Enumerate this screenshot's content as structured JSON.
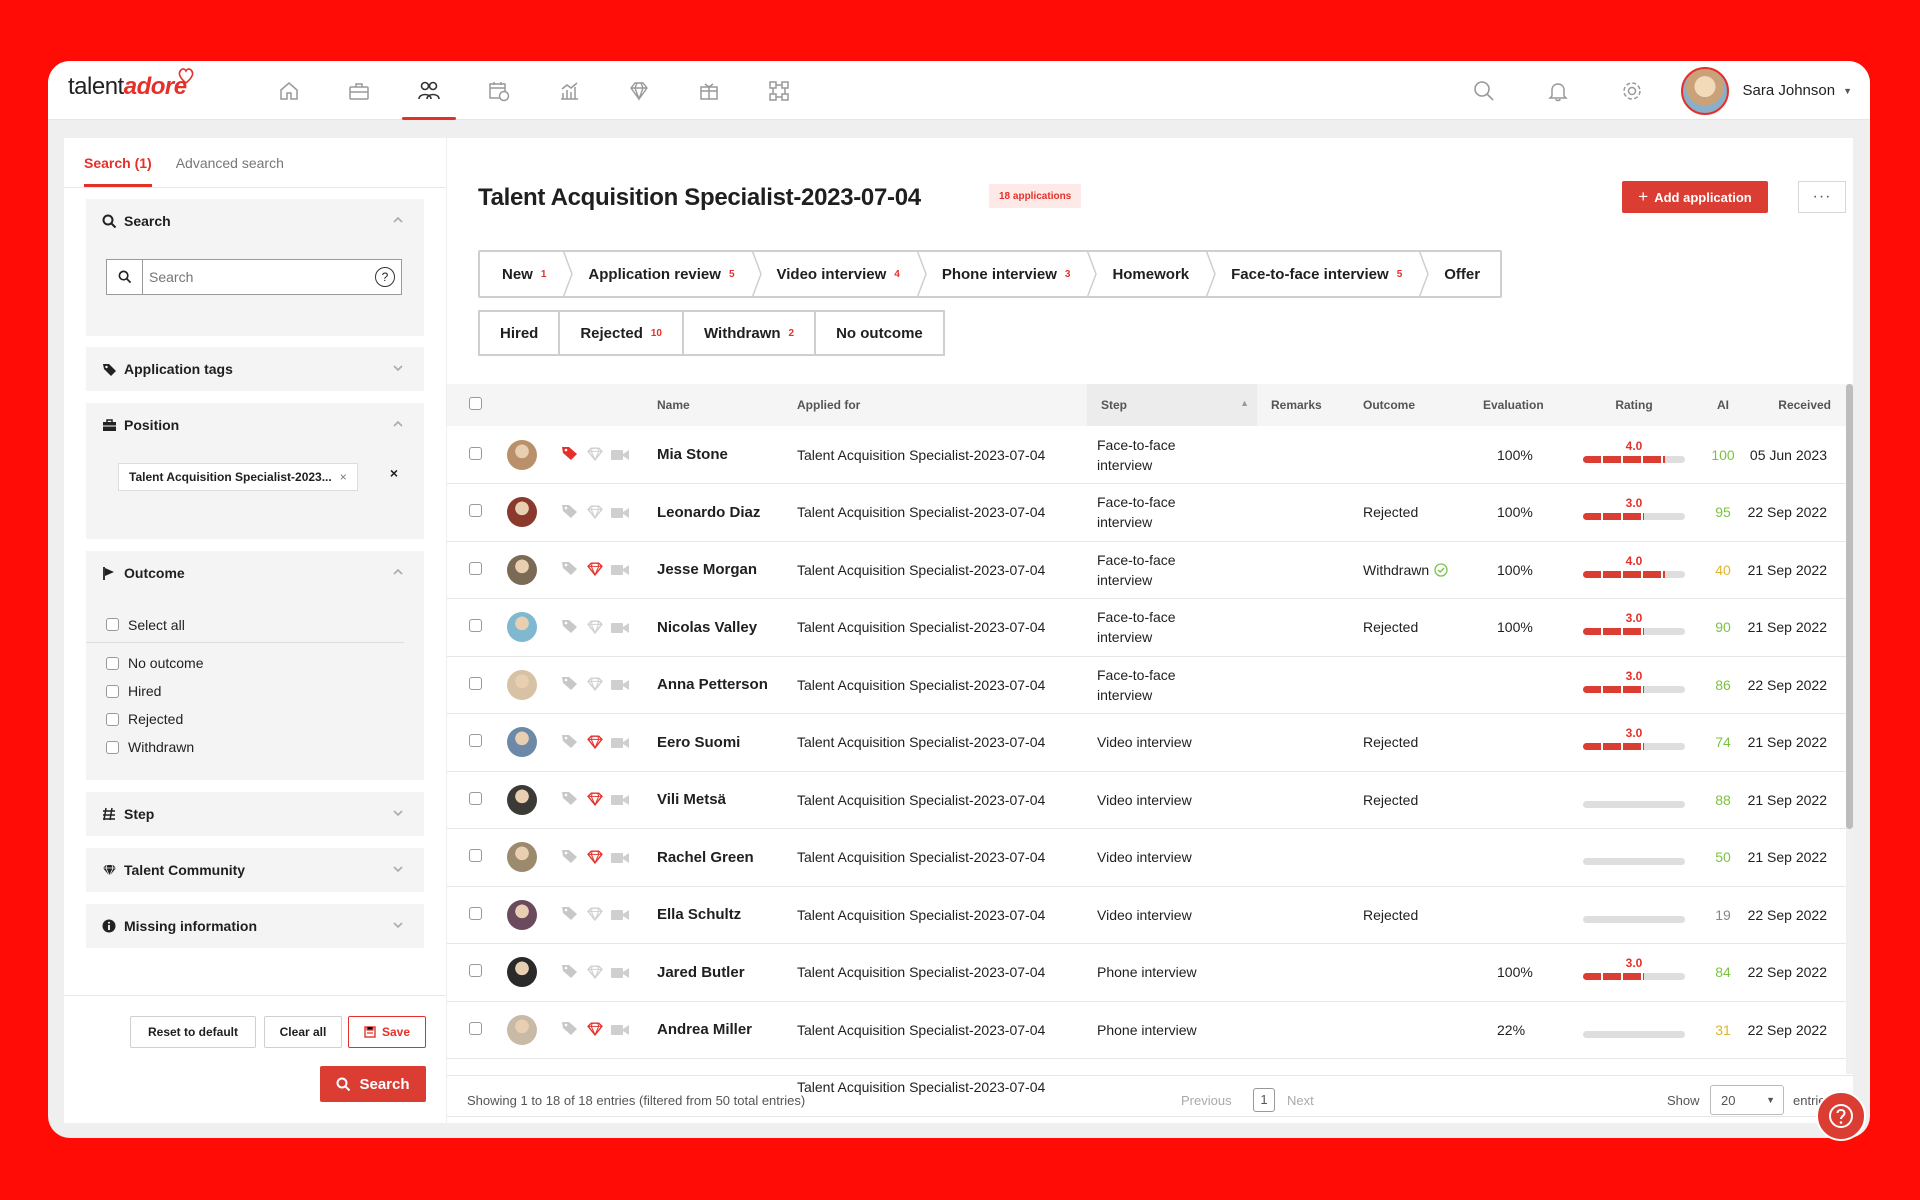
{
  "brand": {
    "logo_prefix": "talent",
    "logo_suffix": "adore"
  },
  "nav": {
    "icons": [
      "home-icon",
      "briefcase-icon",
      "candidates-icon",
      "calendar-icon",
      "analytics-icon",
      "diamond-icon",
      "gift-icon",
      "integrations-icon"
    ],
    "active": 2
  },
  "user": {
    "name": "Sara Johnson"
  },
  "sidebar": {
    "tabs": [
      "Search (1)",
      "Advanced search"
    ],
    "search": {
      "title": "Search",
      "placeholder": "Search",
      "help": "?"
    },
    "application_tags": "Application tags",
    "position": {
      "title": "Position",
      "chip": "Talent Acquisition Specialist-2023...",
      "chip_x": "×",
      "clear": "×"
    },
    "outcome": {
      "title": "Outcome",
      "select_all": "Select all",
      "options": [
        "No outcome",
        "Hired",
        "Rejected",
        "Withdrawn"
      ]
    },
    "step": "Step",
    "talent_community": "Talent Community",
    "missing_information": "Missing information",
    "buttons": {
      "reset": "Reset to default",
      "clear": "Clear all",
      "save": "Save",
      "search": "Search"
    }
  },
  "main": {
    "title": "Talent Acquisition Specialist-2023-07-04",
    "badge": "18 applications",
    "add_button": "Add application",
    "more": "···",
    "steps": [
      {
        "label": "New",
        "count": "1"
      },
      {
        "label": "Application review",
        "count": "5"
      },
      {
        "label": "Video interview",
        "count": "4"
      },
      {
        "label": "Phone interview",
        "count": "3"
      },
      {
        "label": "Homework",
        "count": ""
      },
      {
        "label": "Face-to-face interview",
        "count": "5"
      },
      {
        "label": "Offer",
        "count": ""
      }
    ],
    "outcomes": [
      {
        "label": "Hired",
        "count": ""
      },
      {
        "label": "Rejected",
        "count": "10"
      },
      {
        "label": "Withdrawn",
        "count": "2"
      },
      {
        "label": "No outcome",
        "count": ""
      }
    ],
    "columns": {
      "name": "Name",
      "applied_for": "Applied for",
      "step": "Step",
      "remarks": "Remarks",
      "outcome": "Outcome",
      "evaluation": "Evaluation",
      "rating": "Rating",
      "ai": "AI",
      "received": "Received"
    },
    "rows": [
      {
        "name": "Mia Stone",
        "applied": "Talent Acquisition Specialist-2023-07-04",
        "step": "Face-to-face interview",
        "outcome": "",
        "evaluation": "100%",
        "rating": "4.0",
        "rating_frac": 0.8,
        "ai": "100",
        "ai_color": "#7cc242",
        "received": "05 Jun 2023",
        "tag_active": true,
        "diamond_active": false,
        "avatar": "#b9906a"
      },
      {
        "name": "Leonardo Diaz",
        "applied": "Talent Acquisition Specialist-2023-07-04",
        "step": "Face-to-face interview",
        "outcome": "Rejected",
        "evaluation": "100%",
        "rating": "3.0",
        "rating_frac": 0.6,
        "ai": "95",
        "ai_color": "#7cc242",
        "received": "22 Sep 2022",
        "tag_active": false,
        "diamond_active": false,
        "avatar": "#8a3a2c"
      },
      {
        "name": "Jesse Morgan",
        "applied": "Talent Acquisition Specialist-2023-07-04",
        "step": "Face-to-face interview",
        "outcome": "Withdrawn",
        "outcome_check": true,
        "evaluation": "100%",
        "rating": "4.0",
        "rating_frac": 0.8,
        "ai": "40",
        "ai_color": "#e0b52c",
        "received": "21 Sep 2022",
        "tag_active": false,
        "diamond_active": true,
        "avatar": "#7b6a55"
      },
      {
        "name": "Nicolas Valley",
        "applied": "Talent Acquisition Specialist-2023-07-04",
        "step": "Face-to-face interview",
        "outcome": "Rejected",
        "evaluation": "100%",
        "rating": "3.0",
        "rating_frac": 0.6,
        "ai": "90",
        "ai_color": "#7cc242",
        "received": "21 Sep 2022",
        "tag_active": false,
        "diamond_active": false,
        "avatar": "#7fb8cf"
      },
      {
        "name": "Anna Petterson",
        "applied": "Talent Acquisition Specialist-2023-07-04",
        "step": "Face-to-face interview",
        "outcome": "",
        "evaluation": "",
        "rating": "3.0",
        "rating_frac": 0.6,
        "ai": "86",
        "ai_color": "#7cc242",
        "received": "22 Sep 2022",
        "tag_active": false,
        "diamond_active": false,
        "avatar": "#d8c2a6"
      },
      {
        "name": "Eero Suomi",
        "applied": "Talent Acquisition Specialist-2023-07-04",
        "step": "Video interview",
        "outcome": "Rejected",
        "evaluation": "",
        "rating": "3.0",
        "rating_frac": 0.6,
        "ai": "74",
        "ai_color": "#7cc242",
        "received": "21 Sep 2022",
        "tag_active": false,
        "diamond_active": true,
        "avatar": "#6c8aa8"
      },
      {
        "name": "Vili Metsä",
        "applied": "Talent Acquisition Specialist-2023-07-04",
        "step": "Video interview",
        "outcome": "Rejected",
        "evaluation": "",
        "rating": "",
        "rating_frac": 0,
        "ai": "88",
        "ai_color": "#7cc242",
        "received": "21 Sep 2022",
        "tag_active": false,
        "diamond_active": true,
        "avatar": "#3b3a36"
      },
      {
        "name": "Rachel Green",
        "applied": "Talent Acquisition Specialist-2023-07-04",
        "step": "Video interview",
        "outcome": "",
        "evaluation": "",
        "rating": "",
        "rating_frac": 0,
        "ai": "50",
        "ai_color": "#7cc242",
        "received": "21 Sep 2022",
        "tag_active": false,
        "diamond_active": true,
        "avatar": "#9b8a6d"
      },
      {
        "name": "Ella Schultz",
        "applied": "Talent Acquisition Specialist-2023-07-04",
        "step": "Video interview",
        "outcome": "Rejected",
        "evaluation": "",
        "rating": "",
        "rating_frac": 0,
        "ai": "19",
        "ai_color": "#888888",
        "received": "22 Sep 2022",
        "tag_active": false,
        "diamond_active": false,
        "avatar": "#6b4a5e"
      },
      {
        "name": "Jared Butler",
        "applied": "Talent Acquisition Specialist-2023-07-04",
        "step": "Phone interview",
        "outcome": "",
        "evaluation": "100%",
        "rating": "3.0",
        "rating_frac": 0.6,
        "ai": "84",
        "ai_color": "#7cc242",
        "received": "22 Sep 2022",
        "tag_active": false,
        "diamond_active": false,
        "avatar": "#2a2a2a"
      },
      {
        "name": "Andrea Miller",
        "applied": "Talent Acquisition Specialist-2023-07-04",
        "step": "Phone interview",
        "outcome": "",
        "evaluation": "22%",
        "rating": "",
        "rating_frac": 0,
        "ai": "31",
        "ai_color": "#e0b52c",
        "received": "22 Sep 2022",
        "tag_active": false,
        "diamond_active": true,
        "avatar": "#c9b9a7"
      }
    ],
    "footer": {
      "showing": "Showing 1 to 18 of 18 entries (filtered from 50 total entries)",
      "previous": "Previous",
      "page": "1",
      "next": "Next",
      "show": "Show",
      "page_size": "20",
      "entries": "entries"
    }
  }
}
